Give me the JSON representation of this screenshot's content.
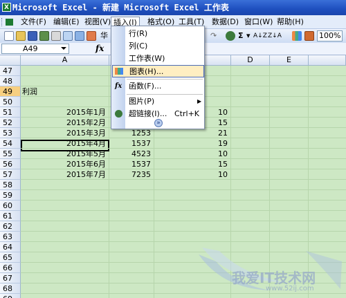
{
  "window": {
    "title": "Microsoft Excel - 新建 Microsoft Excel 工作表",
    "app_icon": "X"
  },
  "menubar": {
    "items": [
      {
        "label": "文件(F)"
      },
      {
        "label": "编辑(E)"
      },
      {
        "label": "视图(V)"
      },
      {
        "label": "插入(I)"
      },
      {
        "label": "格式(O)"
      },
      {
        "label": "工具(T)"
      },
      {
        "label": "数据(D)"
      },
      {
        "label": "窗口(W)"
      },
      {
        "label": "帮助(H)"
      }
    ]
  },
  "toolbar": {
    "font_fragment": "华",
    "sum_symbol": "Σ",
    "zoom": "100%"
  },
  "formula_bar": {
    "name_box": "A49",
    "fx_label": "fx"
  },
  "columns": [
    "A",
    "B",
    "C",
    "D",
    "E"
  ],
  "rows": [
    {
      "num": "47",
      "a": "",
      "b": "",
      "c": ""
    },
    {
      "num": "48",
      "a": "",
      "b": "",
      "c": ""
    },
    {
      "num": "49",
      "a": "利润",
      "b": "",
      "c": ""
    },
    {
      "num": "50",
      "a": "",
      "b": "",
      "c": ""
    },
    {
      "num": "51",
      "a": "2015年1月",
      "b": "",
      "c": "10"
    },
    {
      "num": "52",
      "a": "2015年2月",
      "b": "",
      "c": "15"
    },
    {
      "num": "53",
      "a": "2015年3月",
      "b": "1253",
      "c": "21"
    },
    {
      "num": "54",
      "a": "2015年4月",
      "b": "1537",
      "c": "19"
    },
    {
      "num": "55",
      "a": "2015年5月",
      "b": "4523",
      "c": "10"
    },
    {
      "num": "56",
      "a": "2015年6月",
      "b": "1537",
      "c": "15"
    },
    {
      "num": "57",
      "a": "2015年7月",
      "b": "7235",
      "c": "10"
    },
    {
      "num": "58"
    },
    {
      "num": "59"
    },
    {
      "num": "60"
    },
    {
      "num": "61"
    },
    {
      "num": "62"
    },
    {
      "num": "63"
    },
    {
      "num": "64"
    },
    {
      "num": "65"
    },
    {
      "num": "66"
    },
    {
      "num": "67"
    },
    {
      "num": "68"
    },
    {
      "num": "69"
    }
  ],
  "insert_menu": {
    "items": [
      {
        "label": "行(R)",
        "icon": ""
      },
      {
        "label": "列(C)",
        "icon": ""
      },
      {
        "label": "工作表(W)",
        "icon": ""
      },
      {
        "label": "图表(H)...",
        "icon": "chart-icon"
      },
      {
        "label": "函数(F)...",
        "icon": "function-icon"
      },
      {
        "label": "图片(P)",
        "icon": "",
        "submenu": "▶"
      },
      {
        "label": "超链接(I)...",
        "icon": "hyperlink-icon",
        "shortcut": "Ctrl+K"
      },
      {
        "label": "»",
        "icon": "expand-icon"
      }
    ]
  },
  "watermark": {
    "text": "我爱IT技术网",
    "url": "www.52ij.com"
  }
}
